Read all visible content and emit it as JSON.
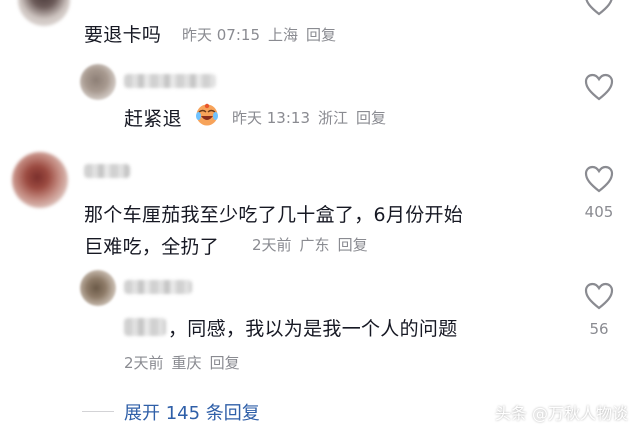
{
  "colors": {
    "text": "#161823",
    "meta": "#8a8b91",
    "link": "#2f5fa8",
    "heart_stroke": "#8a8b91"
  },
  "comments": [
    {
      "text": "要退卡吗",
      "time": "昨天 07:15",
      "location": "上海",
      "reply_label": "回复"
    },
    {
      "text": "赶紧退",
      "emoji": "crying-laughing-emoji-icon",
      "time": "昨天 13:13",
      "location": "浙江",
      "reply_label": "回复"
    },
    {
      "text_line1": "那个车厘茄我至少吃了几十盒了，6月份开始",
      "text_line2": "巨难吃，全扔了",
      "time": "2天前",
      "location": "广东",
      "reply_label": "回复",
      "likes": "405"
    },
    {
      "text": "，同感，我以为是我一个人的问题",
      "time": "2天前",
      "location": "重庆",
      "reply_label": "回复",
      "likes": "56"
    }
  ],
  "expand_label": "展开 145 条回复",
  "watermark": "头条 @万秋人物谈"
}
